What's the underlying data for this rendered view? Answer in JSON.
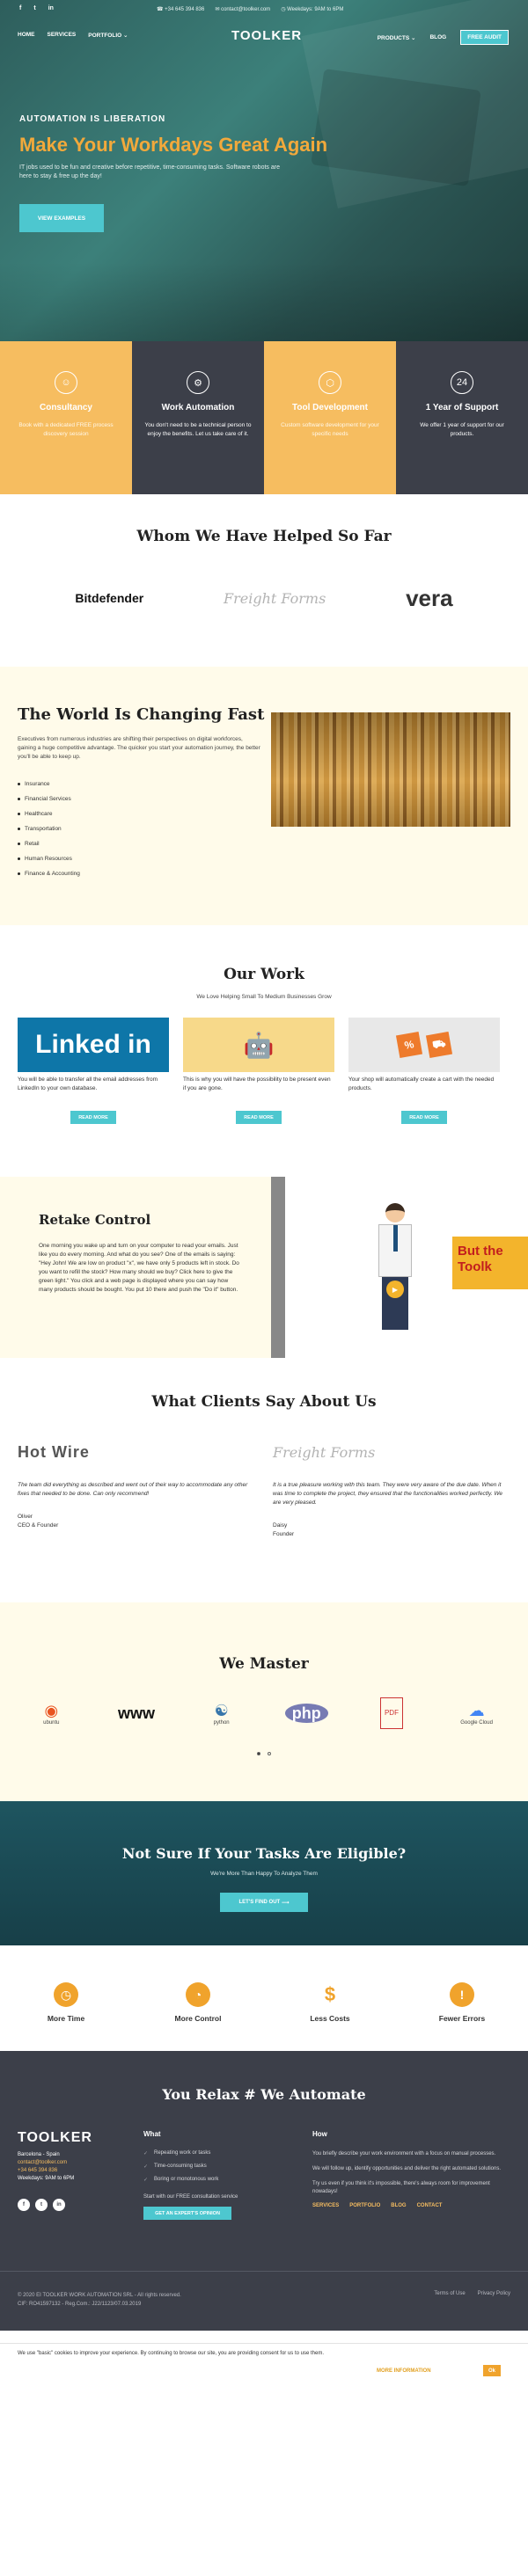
{
  "topbar": {
    "social": [
      "f",
      "t",
      "in"
    ],
    "phone": "+34 645 394 836",
    "email": "contact@toolker.com",
    "hours": "Weekdays: 9AM to 6PM"
  },
  "nav": {
    "home": "HOME",
    "services": "SERVICES",
    "portfolio": "PORTFOLIO",
    "logo": "TOOLKER",
    "products": "PRODUCTS",
    "blog": "BLOG",
    "audit": "FREE AUDIT"
  },
  "hero": {
    "tagline": "AUTOMATION IS LIBERATION",
    "title": "Make Your Workdays Great Again",
    "subtitle": "IT jobs used to be fun and creative before repetitive, time-consuming tasks. Software robots are here to stay & free up the day!",
    "cta": "VIEW EXAMPLES"
  },
  "features": [
    {
      "icon": "☺",
      "title": "Consultancy",
      "text": "Book with a dedicated FREE process discovery session"
    },
    {
      "icon": "⚙",
      "title": "Work Automation",
      "text": "You don't need to be a technical person to enjoy the benefits. Let us take care of it."
    },
    {
      "icon": "⬡",
      "title": "Tool Development",
      "text": "Custom software development for your specific needs"
    },
    {
      "icon": "24",
      "title": "1 Year of Support",
      "text": "We offer 1 year of support for our products."
    }
  ],
  "helped": {
    "title": "Whom We Have Helped So Far",
    "logos": [
      "Bitdefender",
      "Freight Forms",
      "vera"
    ]
  },
  "world": {
    "title": "The World Is Changing Fast",
    "intro": "Executives from numerous industries are shifting their perspectives on digital workforces, gaining a huge competitive advantage. The quicker you start your automation journey, the better you'll be able to keep up.",
    "industries": [
      "Insurance",
      "Financial Services",
      "Healthcare",
      "Transportation",
      "Retail",
      "Human Resources",
      "Finance & Accounting"
    ]
  },
  "work": {
    "title": "Our Work",
    "subtitle": "We Love Helping Small To Medium Businesses Grow",
    "cards": [
      {
        "image": "Linked in",
        "text": "You will be able to transfer all the email addresses from LinkedIn to your own database.",
        "button": "READ MORE"
      },
      {
        "image": "robot",
        "text": "This is why you will have the possibility to be present even if you are gone.",
        "button": "READ MORE"
      },
      {
        "image": "cart",
        "text": "Your shop will automatically create a cart with the needed products.",
        "button": "READ MORE"
      }
    ]
  },
  "retake": {
    "title": "Retake Control",
    "text": "One morning you wake up and turn on your computer to read your emails. Just like you do every morning. And what do you see? One of the emails is saying: \"Hey John! We are low on product \"x\", we have only 5 products left in stock. Do you want to refill the stock? How many should we buy? Click here to give the green light.\" You click and a web page is displayed where you can say how many products should be bought. You put 10 there and push the \"Do it\" button.",
    "video_banner": [
      "But the",
      "Toolk"
    ]
  },
  "clients": {
    "title": "What Clients Say About Us",
    "reviews": [
      {
        "logo": "Hot Wire",
        "quote": "The team did everything as described and went out of their way to accommodate any other fixes that needed to be done. Can only recommend!",
        "name": "Oliver",
        "role": "CEO & Founder"
      },
      {
        "logo": "Freight Forms",
        "quote": "It is a true pleasure working with this team. They were very aware of the due date. When it was time to complete the project, they ensured that the functionalities worked perfectly. We are very pleased.",
        "name": "Daisy",
        "role": "Founder"
      }
    ]
  },
  "master": {
    "title": "We Master",
    "tech": [
      {
        "glyph": "◉",
        "label": "ubuntu"
      },
      {
        "glyph": "www",
        "label": ""
      },
      {
        "glyph": "☯",
        "label": "python"
      },
      {
        "glyph": "php",
        "label": ""
      },
      {
        "glyph": "PDF",
        "label": ""
      },
      {
        "glyph": "☁",
        "label": "Google Cloud"
      }
    ]
  },
  "eligible": {
    "title": "Not Sure If Your Tasks Are Eligible?",
    "subtitle": "We're More Than Happy To Analyze Them",
    "button": "LET'S FIND OUT"
  },
  "benefits": [
    {
      "icon": "◷",
      "label": "More Time"
    },
    {
      "icon": "◔",
      "label": "More Control"
    },
    {
      "icon": "$",
      "label": "Less Costs"
    },
    {
      "icon": "!",
      "label": "Fewer Errors"
    }
  ],
  "footer": {
    "headline": "You Relax # We Automate",
    "brand": {
      "logo": "TOOLKER",
      "location": "Barcelona - Spain",
      "email": "contact@toolker.com",
      "phone": "+34 645 394 836",
      "hours": "Weekdays: 9AM to 6PM",
      "social": [
        "f",
        "t",
        "in"
      ]
    },
    "what": {
      "title": "What",
      "items": [
        "Repeating work or tasks",
        "Time-consuming tasks",
        "Boring or monotonous work"
      ],
      "note": "Start with our FREE consultation service",
      "button": "GET AN EXPERT'S OPINION"
    },
    "how": {
      "title": "How",
      "p1": "You briefly describe your work environment with a focus on manual processes.",
      "p2": "We will follow up, identify opportunities and deliver the right automated solutions.",
      "p3": "Try us even if you think it's impossible, there's always room for improvement nowadays!",
      "links": [
        "SERVICES",
        "PORTFOLIO",
        "BLOG",
        "CONTACT"
      ]
    }
  },
  "bottom": {
    "copyright": "© 2020 EI TOOLKER WORK AUTOMATION SRL - All rights reserved.",
    "cif": "CIF: RO41597132 - Reg.Com.: J22/1123/07.03.2019",
    "terms": "Terms of Use",
    "privacy": "Privacy Policy"
  },
  "cookie": {
    "text": "We use \"basic\" cookies to improve your experience. By continuing to browse our site, you are providing consent for us to use them.",
    "more": "MORE INFORMATION",
    "ok": "Ok"
  },
  "colors": {
    "accent_teal": "#4dc7cf",
    "accent_yellow": "#f6bd60",
    "dark": "#3c3f49",
    "cream": "#fffbea",
    "hero_title": "#f2a93b"
  }
}
